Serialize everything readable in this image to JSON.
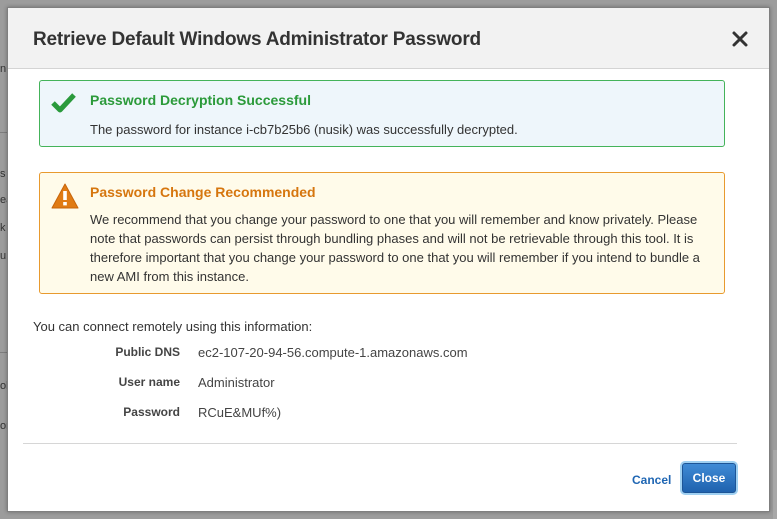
{
  "background": {
    "edge_glyphs": [
      "n",
      "s",
      "ea",
      "k",
      "u",
      "ob",
      "or"
    ]
  },
  "dialog": {
    "title": "Retrieve Default Windows Administrator Password",
    "close_icon": "close-icon"
  },
  "success_alert": {
    "icon": "checkmark-icon",
    "title": "Password Decryption Successful",
    "body": "The password for instance i-cb7b25b6 (nusik) was successfully decrypted.",
    "color": "#2b9a3a"
  },
  "warning_alert": {
    "icon": "warning-triangle-icon",
    "title": "Password Change Recommended",
    "body": "We recommend that you change your password to one that you will remember and know privately. Please note that passwords can persist through bundling phases and will not be retrievable through this tool. It is therefore important that you change your password to one that you will remember if you intend to bundle a new AMI from this instance.",
    "color": "#d6760e"
  },
  "connection": {
    "intro": "You can connect remotely using this information:",
    "public_dns_label": "Public DNS",
    "public_dns_value": "ec2-107-20-94-56.compute-1.amazonaws.com",
    "user_name_label": "User name",
    "user_name_value": "Administrator",
    "password_label": "Password",
    "password_value": "RCuE&MUf%)"
  },
  "footer": {
    "cancel_label": "Cancel",
    "close_label": "Close"
  }
}
